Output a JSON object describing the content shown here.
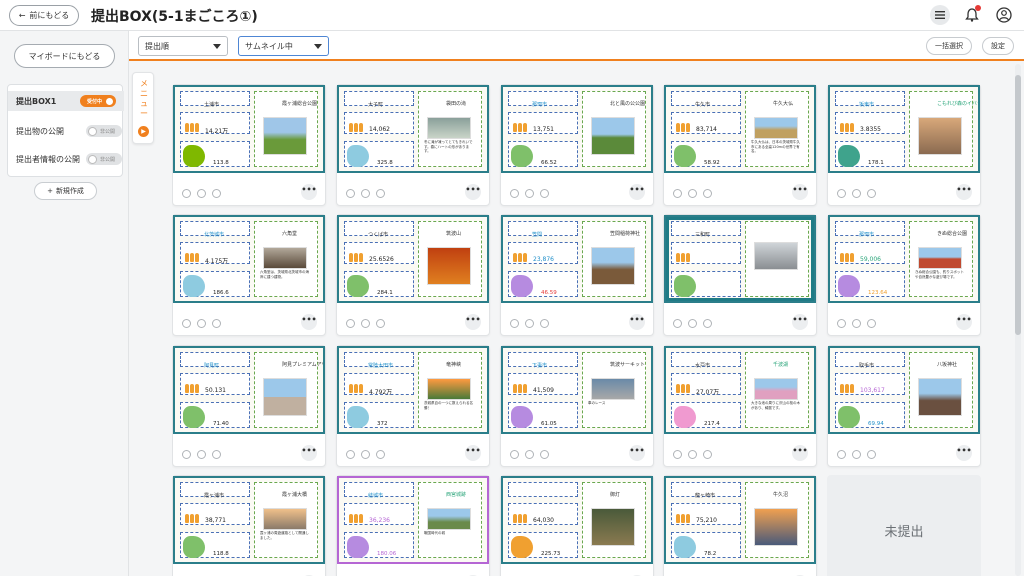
{
  "header": {
    "back_label": "前にもどる",
    "title": "提出BOX(5-1まごころ①)"
  },
  "sidebar": {
    "mypage_label": "マイボードにもどる",
    "box_name": "提出BOX1",
    "box_toggle": "受付中",
    "items": [
      {
        "label": "提出物の公開",
        "toggle": "非公開"
      },
      {
        "label": "提出者情報の公開",
        "toggle": "非公開"
      }
    ],
    "new_label": "新規作成"
  },
  "filters": {
    "order": "提出順",
    "view": "サムネイル中",
    "select_all": "一括選択",
    "settings": "設定"
  },
  "menu_tab": "メニュー",
  "not_submitted_label": "未提出",
  "cards": [
    {
      "city": "土浦市",
      "spot": "霞ヶ浦総合公園",
      "pop": "14.21万",
      "area": "113.8",
      "memo": ""
    },
    {
      "city": "大子町",
      "spot": "袋田の滝",
      "pop": "14,062",
      "area": "325.8",
      "memo": "冬に滝が凍ってとてもきれいです。春にハートの形があります。"
    },
    {
      "city": "那珂市",
      "spot": "北と風の公公園",
      "pop": "13,751",
      "area": "66.52",
      "memo": ""
    },
    {
      "city": "牛久市",
      "spot": "牛久大仏",
      "pop": "83,714",
      "area": "58.92",
      "memo": "牛久大仏は、日本の茨城県牛久市にある全高120mの世界で有名。"
    },
    {
      "city": "坂東市",
      "spot": "こもれび森のイバライド",
      "pop": "3.8355",
      "area": "178.1",
      "memo": ""
    },
    {
      "city": "北茨城市",
      "spot": "六角堂",
      "pop": "4.175万",
      "area": "186.6",
      "memo": "六角堂は、茨城県北茨城市の海岸に建つ建物。"
    },
    {
      "city": "つくば市",
      "spot": "筑波山",
      "pop": "25.6526",
      "area": "284.1",
      "memo": ""
    },
    {
      "city": "笠間",
      "spot": "笠間稲荷神社",
      "pop": "23,876",
      "area": "46.59",
      "memo": ""
    },
    {
      "city": "三和町",
      "spot": "",
      "pop": "",
      "area": "",
      "memo": ""
    },
    {
      "city": "那珂市",
      "spot": "きぬ総合公園",
      "pop": "59,006",
      "area": "123.64",
      "memo": "きぬ総合公園も、釣りスポットや自然豊かな遊び場です。"
    },
    {
      "city": "阿見町",
      "spot": "阿見プレミアムアウトレット",
      "pop": "50.131",
      "area": "71.40",
      "memo": ""
    },
    {
      "city": "常陸太田市",
      "spot": "竜神峡",
      "pop": "4.792万",
      "area": "372",
      "memo": "茨城県百の一つに数えられる名勝！"
    },
    {
      "city": "下妻市",
      "spot": "筑波サーキット",
      "pop": "41,509",
      "area": "61.05",
      "memo": "車のレース"
    },
    {
      "city": "水戸市",
      "spot": "千波湖",
      "pop": "27.07万",
      "area": "217.4",
      "memo": "大きな池の周りに沢山の桜の木があり、綺麗です。"
    },
    {
      "city": "取手市",
      "spot": "八坂神社",
      "pop": "103,617",
      "area": "69.94",
      "memo": ""
    },
    {
      "city": "霞ヶ浦市",
      "spot": "霞ヶ浦大橋",
      "pop": "38,771",
      "area": "118.8",
      "memo": "霞ヶ浦の周遊道路として開通しました。"
    },
    {
      "city": "結城市",
      "spot": "西宮城跡",
      "pop": "36,236",
      "area": "180.06",
      "memo": "戦国時代の城"
    },
    {
      "city": "",
      "spot": "御灯",
      "pop": "64,030",
      "area": "225.73",
      "memo": ""
    },
    {
      "city": "龍ヶ崎市",
      "spot": "牛久沼",
      "pop": "75,210",
      "area": "78.2",
      "memo": ""
    }
  ],
  "colors": {
    "accent": "#f0801e",
    "card_border": "#2b7e8a",
    "purple_border": "#b566d4"
  }
}
